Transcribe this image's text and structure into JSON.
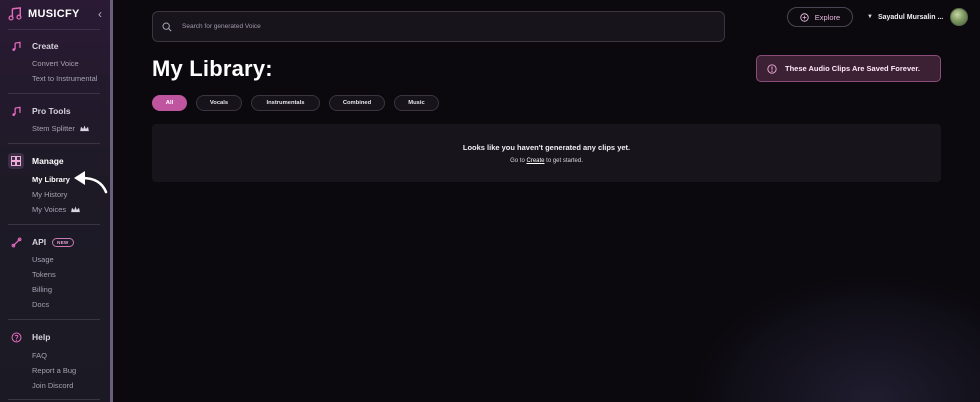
{
  "sidebar": {
    "brand": "MUSICFY",
    "collapse_icon": "chevron-left-icon",
    "sections": {
      "create": {
        "title": "Create",
        "icon": "music-note-icon",
        "items": [
          "Convert Voice",
          "Text to Instrumental"
        ]
      },
      "pro_tools": {
        "title": "Pro Tools",
        "icon": "music-note-icon",
        "items": [
          "Stem Splitter"
        ]
      },
      "manage": {
        "title": "Manage",
        "icon": "grid-icon",
        "items": [
          "My Library",
          "My History",
          "My Voices"
        ]
      },
      "api": {
        "title": "API",
        "badge": "NEW",
        "icon": "link-icon",
        "items": [
          "Usage",
          "Tokens",
          "Billing",
          "Docs"
        ]
      },
      "help": {
        "title": "Help",
        "icon": "help-icon",
        "items": [
          "FAQ",
          "Report a Bug",
          "Join Discord"
        ]
      }
    },
    "active_item": "My Library"
  },
  "header": {
    "search_placeholder": "Search for generated Voice",
    "explore_label": "Explore",
    "user_name": "Sayadul Mursalin ..."
  },
  "main": {
    "title": "My Library:",
    "saved_banner": "These Audio Clips Are Saved Forever.",
    "filters": [
      "All",
      "Vocals",
      "Instrumentals",
      "Combined",
      "Music"
    ],
    "active_filter": "All",
    "empty_title": "Looks like you haven't generated any clips yet.",
    "empty_prefix": "Go to",
    "empty_link": "Create",
    "empty_suffix": "to get started."
  },
  "colors": {
    "accent": "#c0559f",
    "banner_bg": "#3c2034",
    "sidebar_bg": "#1d1a26",
    "page_bg": "#0b090e"
  }
}
